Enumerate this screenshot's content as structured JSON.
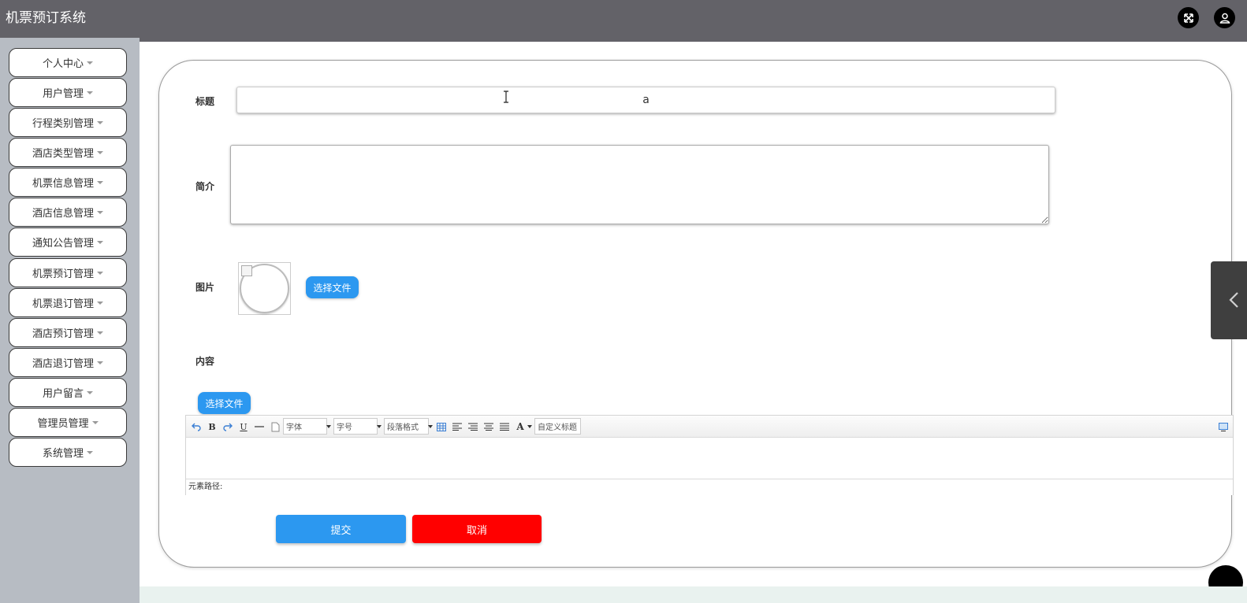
{
  "app": {
    "title": "机票预订系统"
  },
  "topbar": {
    "icons": [
      "fullscreen-icon",
      "user-icon"
    ]
  },
  "sidebar": {
    "items": [
      {
        "label": "个人中心"
      },
      {
        "label": "用户管理"
      },
      {
        "label": "行程类别管理"
      },
      {
        "label": "酒店类型管理"
      },
      {
        "label": "机票信息管理"
      },
      {
        "label": "酒店信息管理"
      },
      {
        "label": "通知公告管理"
      },
      {
        "label": "机票预订管理"
      },
      {
        "label": "机票退订管理"
      },
      {
        "label": "酒店预订管理"
      },
      {
        "label": "酒店退订管理"
      },
      {
        "label": "用户留言"
      },
      {
        "label": "管理员管理"
      },
      {
        "label": "系统管理"
      }
    ]
  },
  "form": {
    "title_label": "标题",
    "title_value": "a",
    "intro_label": "简介",
    "intro_value": "",
    "image_label": "图片",
    "image_choose_button": "选择文件",
    "content_label": "内容",
    "content_choose_button": "选择文件",
    "submit_label": "提交",
    "cancel_label": "取消"
  },
  "editor": {
    "font_family_select": "字体",
    "font_size_select": "字号",
    "paragraph_select": "段落格式",
    "custom_title_select": "自定义标题",
    "bold": "B",
    "underline": "U",
    "font_color": "A",
    "status_text": "元素路径:",
    "toolbar_icons": [
      "undo-icon",
      "bold-icon",
      "redo-icon",
      "underline-icon",
      "horizontal-rule-icon",
      "blank-page-icon",
      "table-icon",
      "align-left-icon",
      "align-center-icon",
      "align-right-icon",
      "align-justify-icon",
      "font-color-icon",
      "preview-icon"
    ]
  },
  "colors": {
    "topbar": "#636268",
    "sidebar": "#b7bcc3",
    "primary": "#2c98f0",
    "danger": "#ff0000"
  }
}
